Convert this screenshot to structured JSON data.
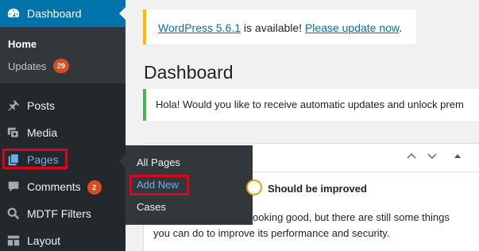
{
  "sidebar": {
    "dashboard": {
      "label": "Dashboard",
      "icon": "dashboard-icon"
    },
    "submenu": {
      "home": "Home",
      "updates": "Updates",
      "updates_count": "29"
    },
    "items": [
      {
        "label": "Posts",
        "icon": "pin-icon"
      },
      {
        "label": "Media",
        "icon": "media-icon"
      },
      {
        "label": "Pages",
        "icon": "pages-icon"
      },
      {
        "label": "Comments",
        "icon": "comment-icon",
        "count": "2"
      },
      {
        "label": "MDTF Filters",
        "icon": "search-icon"
      },
      {
        "label": "Layout",
        "icon": "layout-icon"
      }
    ],
    "flyout": [
      "All Pages",
      "Add New",
      "Cases"
    ]
  },
  "notices": {
    "update": {
      "version_link": "WordPress 5.6.1",
      "middle": " is available! ",
      "action_link": "Please update now",
      "end": "."
    },
    "info": "Hola! Would you like to receive automatic updates and unlock prem"
  },
  "main": {
    "title": "Dashboard"
  },
  "site_health": {
    "status": "Should be improved",
    "line1": "ooking good, but there are still some things",
    "line2": "you can do to improve its performance and security."
  },
  "colors": {
    "accent": "#0073aa",
    "highlight_box": "#e2001a",
    "badge": "#d54e21"
  }
}
